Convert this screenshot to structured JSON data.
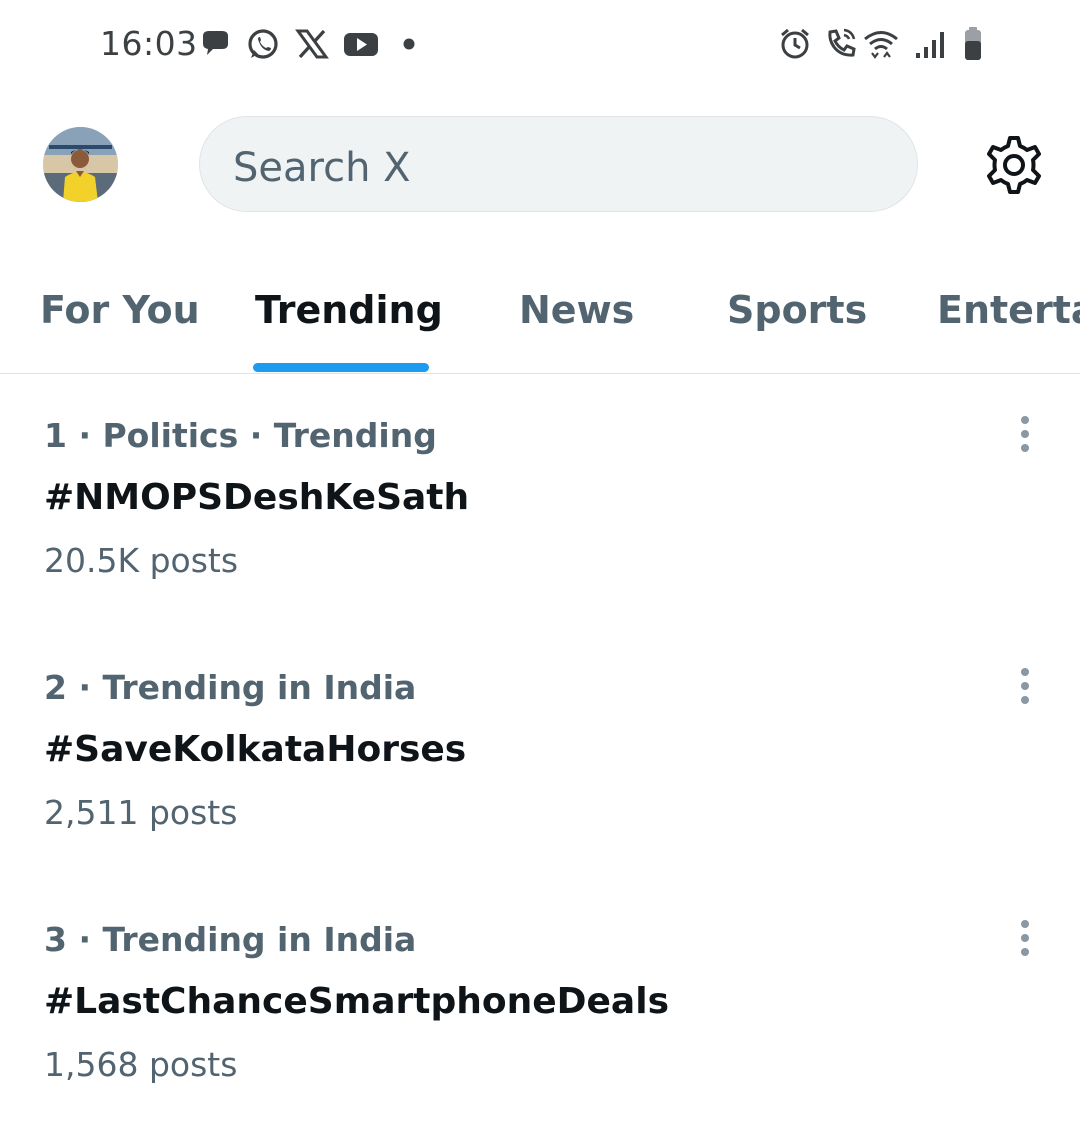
{
  "status_bar": {
    "time": "16:03",
    "left_icons": [
      "chat-bubble-icon",
      "whatsapp-icon",
      "x-logo-icon",
      "youtube-icon",
      "dot-icon"
    ],
    "right_icons": [
      "alarm-icon",
      "wifi-calling-icon",
      "wifi-icon",
      "signal-icon",
      "battery-icon"
    ]
  },
  "header": {
    "search_placeholder": "Search X"
  },
  "tabs": [
    {
      "label": "For You",
      "active": false
    },
    {
      "label": "Trending",
      "active": true
    },
    {
      "label": "News",
      "active": false
    },
    {
      "label": "Sports",
      "active": false
    },
    {
      "label": "Enterta",
      "active": false
    }
  ],
  "colors": {
    "accent": "#1d9bf0",
    "primary_text": "#0f1419",
    "secondary_text": "#536471",
    "search_bg": "#eff3f4"
  },
  "trends": [
    {
      "meta": "1 · Politics · Trending",
      "title": "#NMOPSDeshKeSath",
      "count": "20.5K posts"
    },
    {
      "meta": "2 · Trending in India",
      "title": "#SaveKolkataHorses",
      "count": "2,511 posts"
    },
    {
      "meta": "3 · Trending in India",
      "title": "#LastChanceSmartphoneDeals",
      "count": "1,568 posts"
    }
  ]
}
